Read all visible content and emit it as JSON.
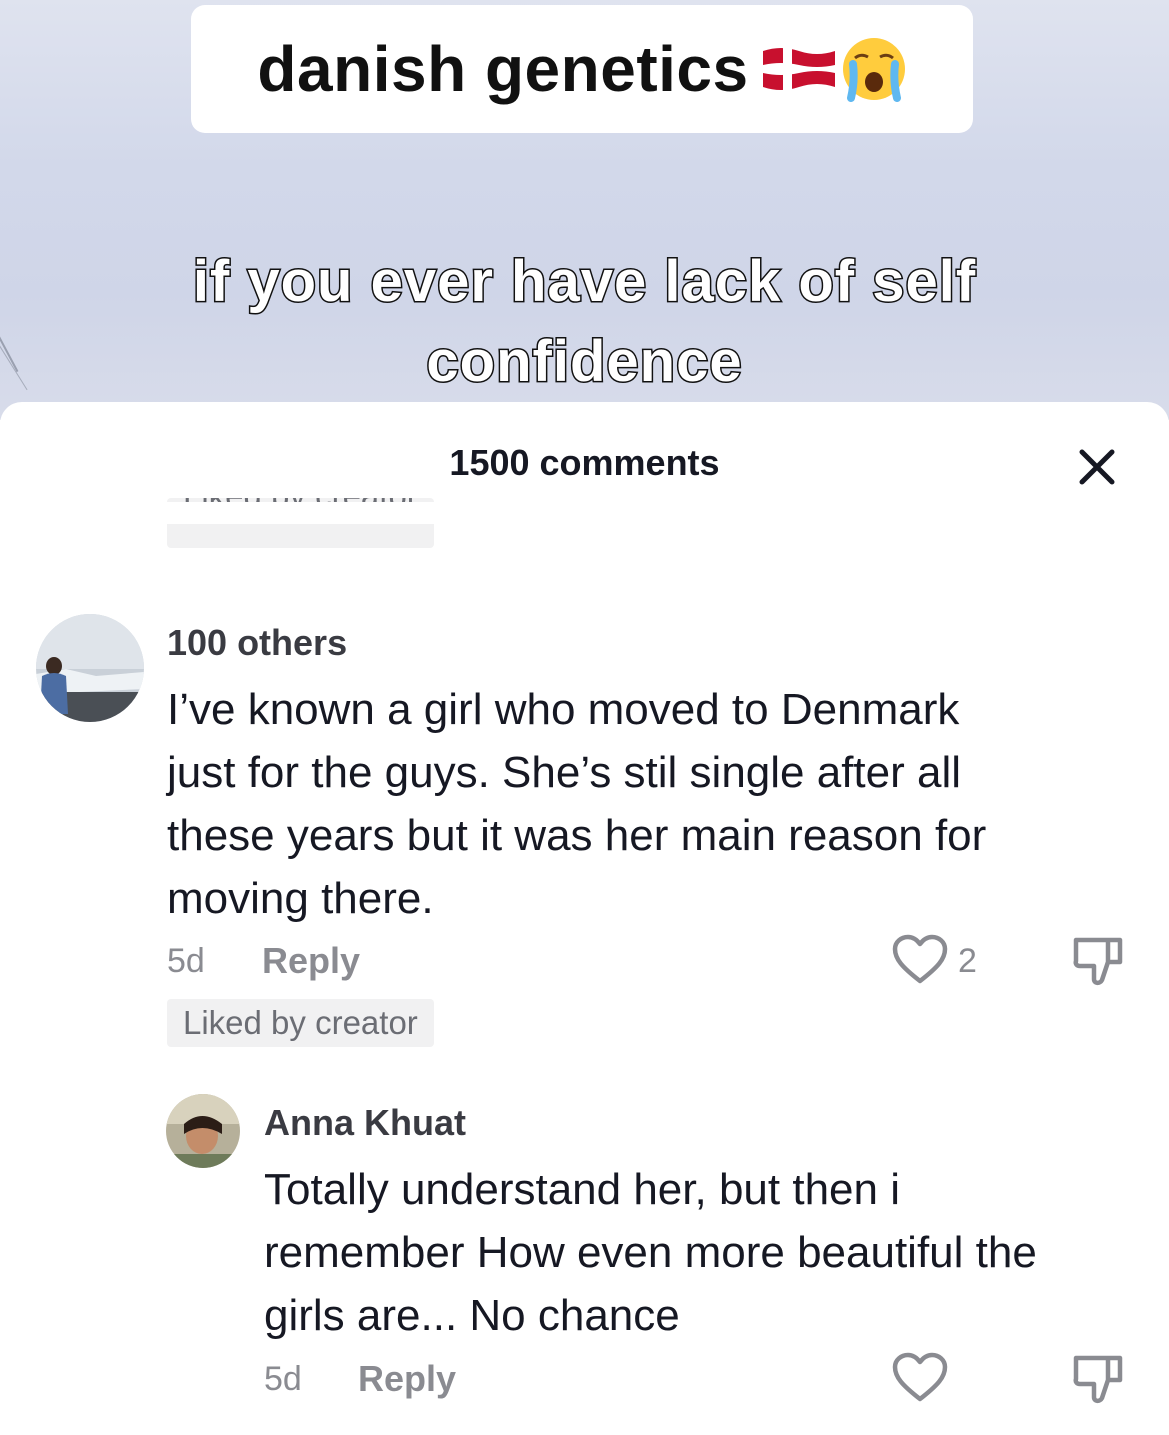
{
  "video": {
    "title": "danish genetics",
    "caption_line1": "if you ever have lack of self",
    "caption_line2": "confidence"
  },
  "comments_panel": {
    "header": "1500 comments",
    "close_icon": "close-icon",
    "clipped_badge": "Liked by creator",
    "comments": [
      {
        "username": "100 others",
        "text_lines": [
          "I’ve known a girl who moved to Denmark",
          "just for the guys. She’s stil single after all",
          "these years but it was her main reason for",
          "moving there."
        ],
        "time": "5d",
        "reply_label": "Reply",
        "like_count": "2",
        "badge": "Liked by creator"
      },
      {
        "username": "Anna Khuat",
        "text_lines": [
          "Totally understand her, but then i",
          "remember How even more beautiful the",
          "girls are... No chance"
        ],
        "time": "5d",
        "reply_label": "Reply"
      }
    ]
  },
  "icons": [
    "denmark-flag-icon",
    "crying-face-icon",
    "close-icon",
    "heart-icon",
    "dislike-icon"
  ],
  "colors": {
    "flag_red": "#c8102e",
    "text_muted": "#8a8b91",
    "badge_bg": "#f1f1f2"
  }
}
